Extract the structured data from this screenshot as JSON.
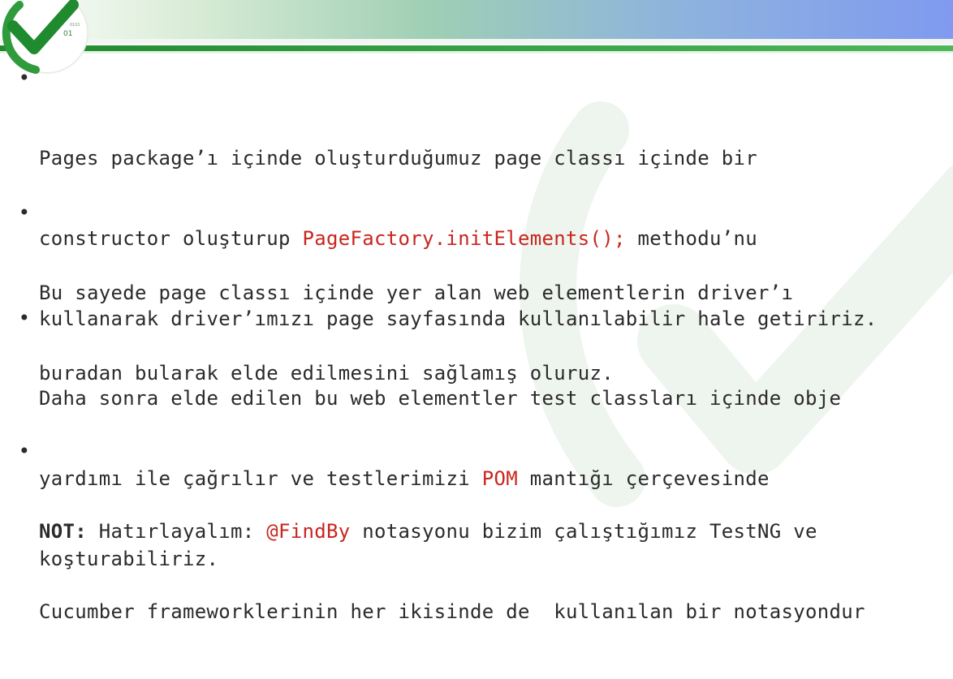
{
  "logo": {
    "icon": "checkmark-logo",
    "binary_text": "01",
    "binary_small": "0101"
  },
  "bullets": [
    {
      "line1_a": "Pages package’ı içinde oluşturduğumuz page classı içinde bir",
      "line2_a": "constructor oluşturup ",
      "line2_code": "PageFactory.initElements();",
      "line2_b": " methodu’nu",
      "line3": "kullanarak driver’ımızı page sayfasında kullanılabilir hale getiririz."
    },
    {
      "line1": "Bu sayede page classı içinde yer alan web elementlerin driver’ı",
      "line2": "buradan bularak elde edilmesini sağlamış oluruz."
    },
    {
      "line1": "Daha sonra elde edilen bu web elementler test classları içinde obje",
      "line2_a": "yardımı ile çağrılır ve testlerimizi ",
      "line2_pom": "POM",
      "line2_b": " mantığı çerçevesinde",
      "line3": "koşturabiliriz."
    },
    {
      "note_label": "NOT:",
      "line1_a": " Hatırlayalım: ",
      "line1_code": "@FindBy",
      "line1_b": " notasyonu bizim çalıştığımız TestNG ve",
      "line2": "Cucumber frameworklerinin her ikisinde de  kullanılan bir notasyondur"
    }
  ],
  "colors": {
    "accent_red": "#c8261f",
    "brand_green": "#1f8a2e",
    "text": "#2b2b2b"
  }
}
